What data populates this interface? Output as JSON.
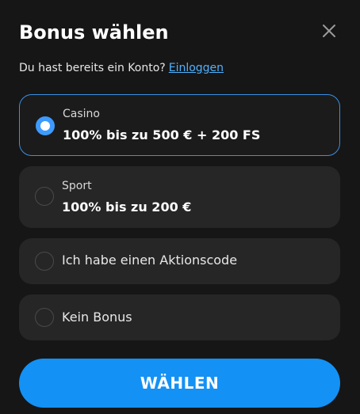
{
  "modal": {
    "title": "Bonus wählen",
    "close_icon": "close-icon"
  },
  "login": {
    "prompt": "Du hast bereits ein Konto?",
    "link": "Einloggen"
  },
  "options": [
    {
      "label": "Casino",
      "value": "100% bis zu 500 € + 200 FS",
      "selected": true
    },
    {
      "label": "Sport",
      "value": "100% bis zu 200 €",
      "selected": false
    },
    {
      "label": "Ich habe einen Aktionscode",
      "selected": false
    },
    {
      "label": "Kein Bonus",
      "selected": false
    }
  ],
  "cta": {
    "label": "WÄHLEN"
  },
  "colors": {
    "background": "#161616",
    "card": "#262626",
    "accent": "#1491f4",
    "link": "#4fb2ff",
    "selected_border": "#3b8fe6"
  }
}
